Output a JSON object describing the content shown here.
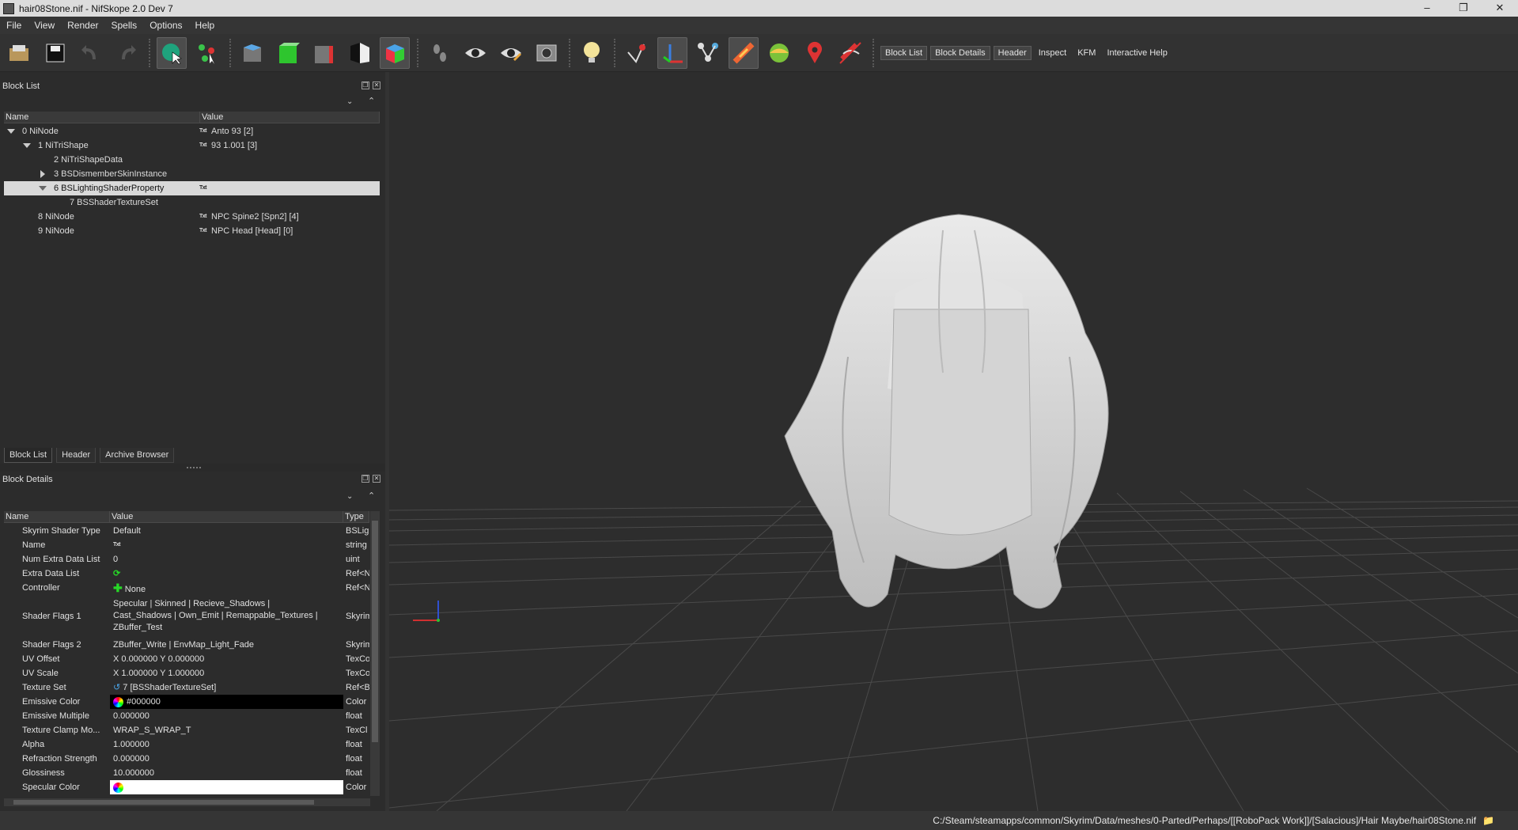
{
  "window": {
    "title": "hair08Stone.nif - NifSkope 2.0 Dev 7"
  },
  "menu": [
    "File",
    "View",
    "Render",
    "Spells",
    "Options",
    "Help"
  ],
  "toolbar": {
    "text_buttons": [
      "Block List",
      "Block Details",
      "Header",
      "Inspect",
      "KFM",
      "Interactive Help"
    ]
  },
  "block_list": {
    "title": "Block List",
    "columns": [
      "Name",
      "Value"
    ],
    "rows": [
      {
        "name": "0 NiNode",
        "value": "Anto 93  [2]"
      },
      {
        "name": "1 NiTriShape",
        "value": "93 1.001 [3]"
      },
      {
        "name": "2 NiTriShapeData",
        "value": ""
      },
      {
        "name": "3 BSDismemberSkinInstance",
        "value": ""
      },
      {
        "name": "6 BSLightingShaderProperty",
        "value": ""
      },
      {
        "name": "7 BSShaderTextureSet",
        "value": ""
      },
      {
        "name": "8 NiNode",
        "value": "NPC Spine2 [Spn2] [4]"
      },
      {
        "name": "9 NiNode",
        "value": "NPC Head [Head] [0]"
      }
    ]
  },
  "tabs": [
    "Block List",
    "Header",
    "Archive Browser"
  ],
  "block_details": {
    "title": "Block Details",
    "columns": [
      "Name",
      "Value",
      "Type"
    ],
    "rows": [
      {
        "name": "Skyrim Shader Type",
        "value": "Default",
        "type": "BSLig"
      },
      {
        "name": "Name",
        "value": "",
        "type": "string"
      },
      {
        "name": "Num Extra Data List",
        "value": "0",
        "type": "uint"
      },
      {
        "name": "Extra Data List",
        "value": "",
        "type": "Ref<N"
      },
      {
        "name": "Controller",
        "value": "None",
        "type": "Ref<N"
      },
      {
        "name": "Shader Flags 1",
        "value": "Specular | Skinned | Recieve_Shadows | Cast_Shadows | Own_Emit | Remappable_Textures | ZBuffer_Test",
        "type": "Skyrim"
      },
      {
        "name": "Shader Flags 2",
        "value": "ZBuffer_Write | EnvMap_Light_Fade",
        "type": "Skyrim"
      },
      {
        "name": "UV Offset",
        "value": "X 0.000000 Y 0.000000",
        "type": "TexCo"
      },
      {
        "name": "UV Scale",
        "value": "X 1.000000 Y 1.000000",
        "type": "TexCo"
      },
      {
        "name": "Texture Set",
        "value": "7 [BSShaderTextureSet]",
        "type": "Ref<B"
      },
      {
        "name": "Emissive Color",
        "value": "#000000",
        "type": "Color"
      },
      {
        "name": "Emissive Multiple",
        "value": "0.000000",
        "type": "float"
      },
      {
        "name": "Texture Clamp Mo...",
        "value": "WRAP_S_WRAP_T",
        "type": "TexCl"
      },
      {
        "name": "Alpha",
        "value": "1.000000",
        "type": "float"
      },
      {
        "name": "Refraction Strength",
        "value": "0.000000",
        "type": "float"
      },
      {
        "name": "Glossiness",
        "value": "10.000000",
        "type": "float"
      },
      {
        "name": "Specular Color",
        "value": "",
        "type": "Color"
      }
    ]
  },
  "status": {
    "path": "C:/Steam/steamapps/common/Skyrim/Data/meshes/0-Parted/Perhaps/[[RoboPack Work]]/[Salacious]/Hair Maybe/hair08Stone.nif"
  },
  "txt_icon": "Txt",
  "colors": {
    "accent_green": "#27d827",
    "selected_row": "#d9d9d9",
    "viewport_bg": "#2d2d2d"
  }
}
